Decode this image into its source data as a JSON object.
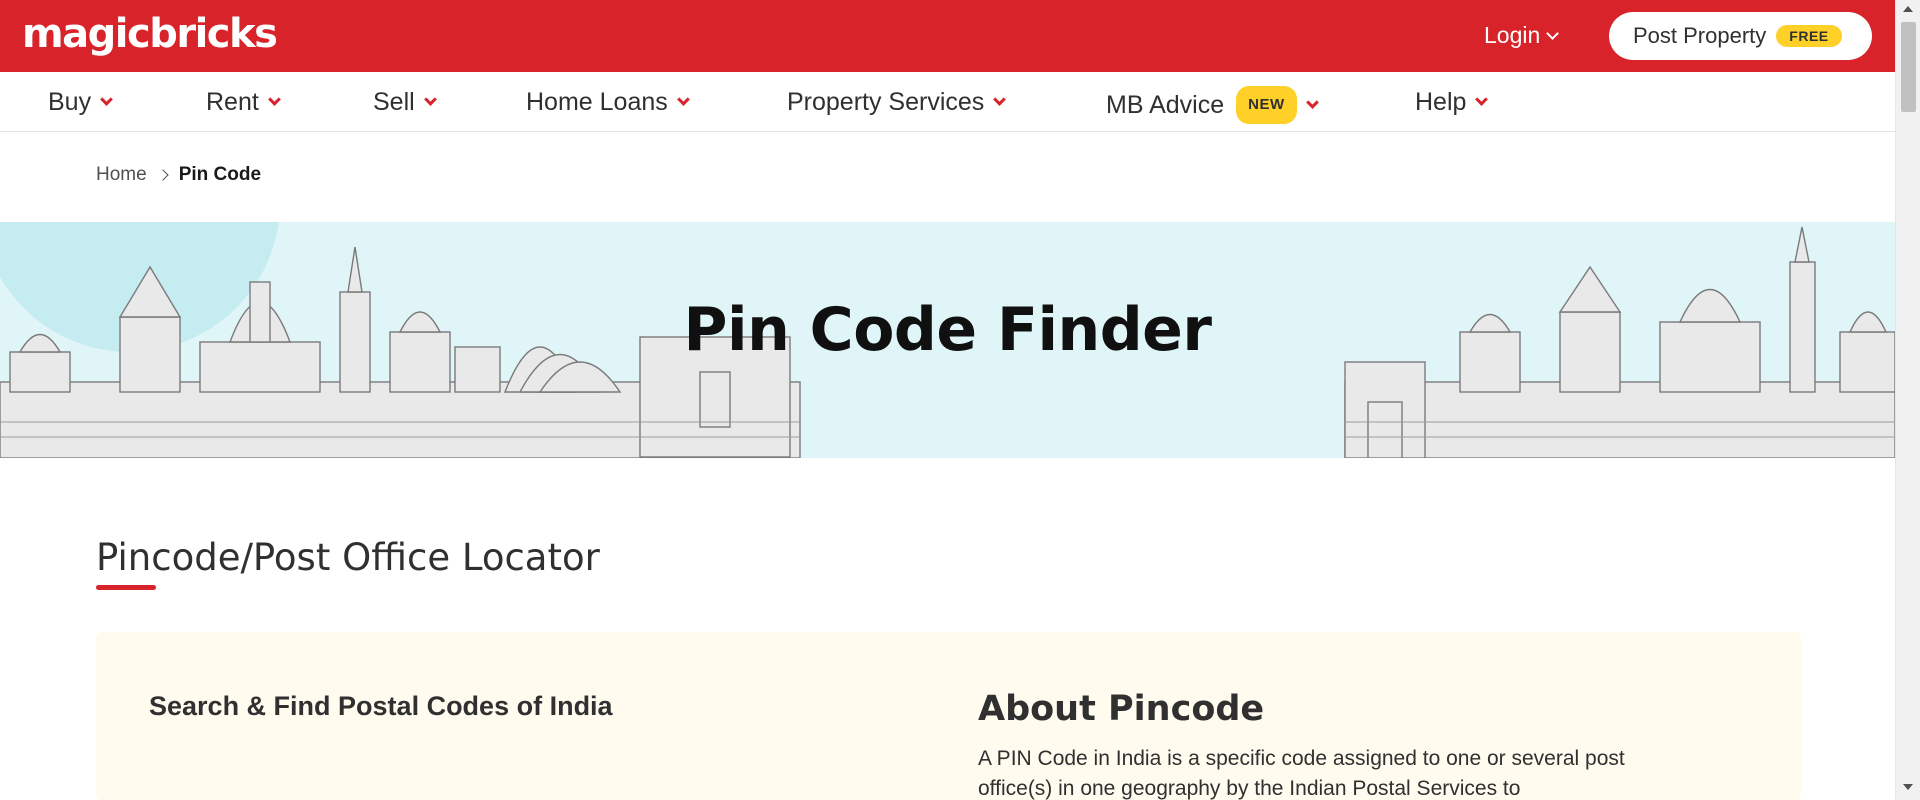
{
  "header": {
    "logo": "magicbricks",
    "login_label": "Login",
    "post_property_label": "Post Property",
    "free_badge": "FREE"
  },
  "nav": {
    "items": [
      {
        "label": "Buy"
      },
      {
        "label": "Rent"
      },
      {
        "label": "Sell"
      },
      {
        "label": "Home Loans"
      },
      {
        "label": "Property Services"
      },
      {
        "label": "MB Advice",
        "badge": "NEW"
      },
      {
        "label": "Help"
      }
    ]
  },
  "breadcrumb": {
    "home": "Home",
    "current": "Pin Code"
  },
  "banner": {
    "title": "Pin Code Finder"
  },
  "section": {
    "title": "Pincode/Post Office Locator",
    "search_heading": "Search & Find Postal Codes of India",
    "about_heading": "About Pincode",
    "about_text": "A PIN Code in India is a specific code assigned to one or several post office(s) in one geography by the Indian Postal Services to"
  },
  "colors": {
    "brand_red": "#d8232a",
    "badge_yellow": "#ffd028",
    "banner_bg": "#dff5f7",
    "card_bg": "#fffbef"
  },
  "icons": [
    "chevron-down-icon",
    "chevron-right-icon",
    "skyline-illustration"
  ]
}
